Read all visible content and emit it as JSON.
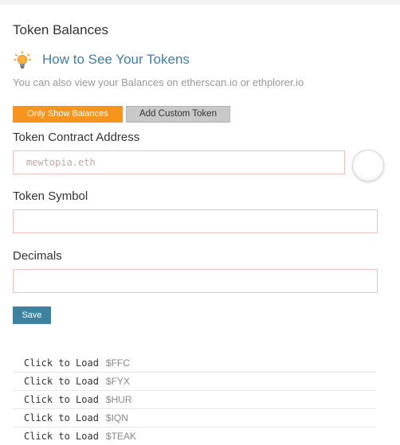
{
  "section_title": "Token Balances",
  "howto": {
    "title": "How to See Your Tokens",
    "icon": "lightbulb-icon"
  },
  "subtext": "You can also view your Balances on etherscan.io or ethplorer.io",
  "buttons": {
    "only_show_balances": "Only Show Balances",
    "add_custom_token": "Add Custom Token",
    "save": "Save"
  },
  "form": {
    "contract_address": {
      "label": "Token Contract Address",
      "placeholder": "mewtopia.eth",
      "value": ""
    },
    "symbol": {
      "label": "Token Symbol",
      "value": ""
    },
    "decimals": {
      "label": "Decimals",
      "value": ""
    }
  },
  "tokens": [
    {
      "action": "Click to Load",
      "symbol": "$FFC"
    },
    {
      "action": "Click to Load",
      "symbol": "$FYX"
    },
    {
      "action": "Click to Load",
      "symbol": "$HUR"
    },
    {
      "action": "Click to Load",
      "symbol": "$IQN"
    },
    {
      "action": "Click to Load",
      "symbol": "$TEAK"
    }
  ],
  "colors": {
    "accent_orange": "#f7941d",
    "link_blue": "#3d7fa6",
    "save_blue": "#3d82a0",
    "field_border": "#f0c2bd"
  }
}
